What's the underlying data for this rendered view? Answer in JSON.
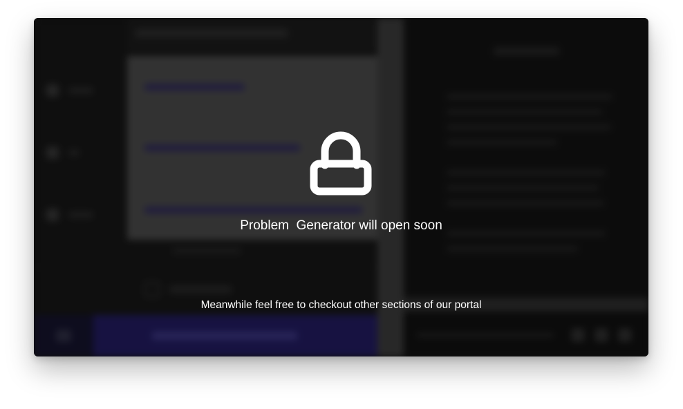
{
  "overlay": {
    "icon": "lock-icon",
    "title": "Problem  Generator will open soon",
    "subtitle": "Meanwhile feel free to checkout other sections of our portal"
  },
  "colors": {
    "card_background": "#1b1b1b",
    "cta_accent": "#2a2277",
    "text": "#ffffff"
  }
}
